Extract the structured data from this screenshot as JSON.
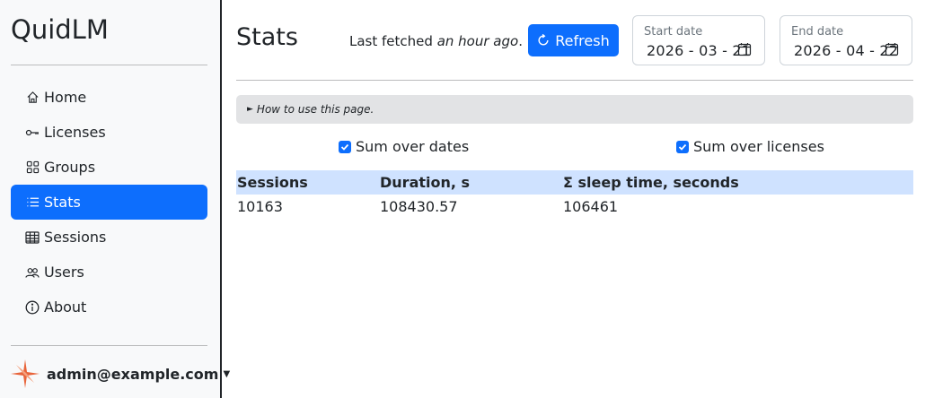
{
  "brand": "QuidLM",
  "nav": [
    {
      "label": "Home",
      "icon": "house-icon"
    },
    {
      "label": "Licenses",
      "icon": "key-icon"
    },
    {
      "label": "Groups",
      "icon": "grid-icon"
    },
    {
      "label": "Stats",
      "icon": "list-icon",
      "active": true
    },
    {
      "label": "Sessions",
      "icon": "table-icon"
    },
    {
      "label": "Users",
      "icon": "people-icon"
    },
    {
      "label": "About",
      "icon": "info-circle-icon"
    }
  ],
  "user": {
    "email": "admin@example.com"
  },
  "page": {
    "title": "Stats",
    "fetched_prefix": "Last fetched",
    "fetched_time": "an hour ago",
    "fetched_suffix": ".",
    "refresh_label": "Refresh",
    "start_date": {
      "label": "Start date",
      "value": "2026 - 03 - 21"
    },
    "end_date": {
      "label": "End date",
      "value": "2026 - 04 - 22"
    },
    "howto": "How to use this page.",
    "sum_dates": {
      "label": "Sum over dates",
      "checked": true
    },
    "sum_licenses": {
      "label": "Sum over licenses",
      "checked": true
    }
  },
  "table": {
    "headers": [
      "Sessions",
      "Duration, s",
      "Σ sleep time, seconds"
    ],
    "rows": [
      [
        "10163",
        "108430.57",
        "106461"
      ]
    ]
  },
  "colors": {
    "accent": "#0d6efd",
    "header_bg": "#cfe2ff",
    "howto_bg": "#e2e3e5"
  }
}
